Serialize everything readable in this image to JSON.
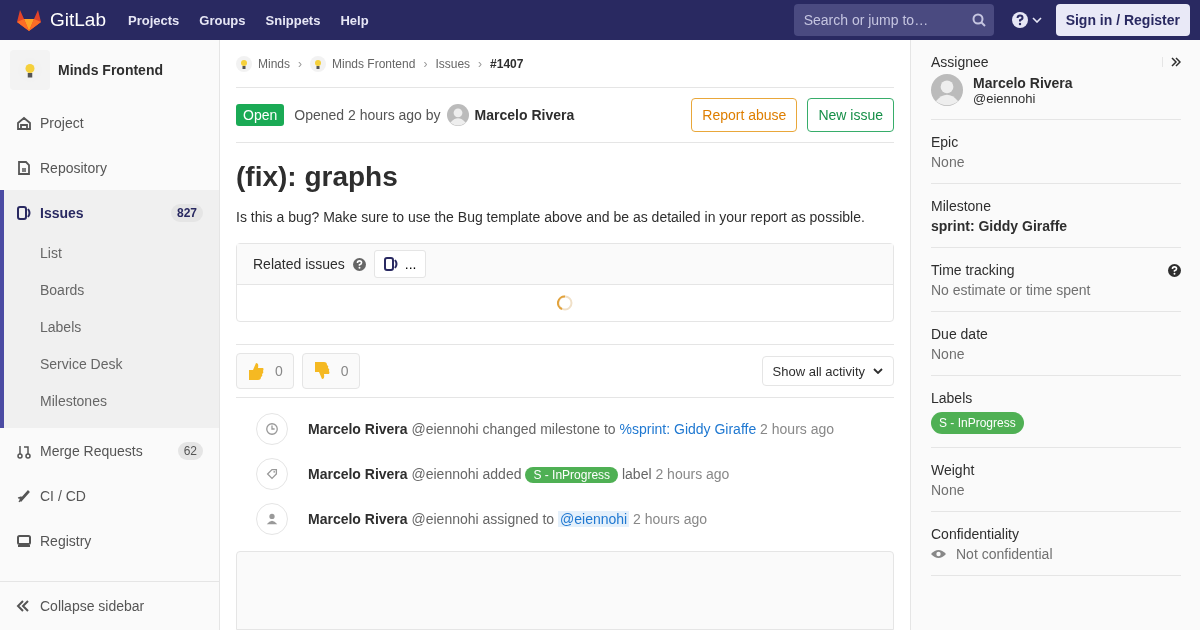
{
  "topbar": {
    "brand": "GitLab",
    "nav": [
      "Projects",
      "Groups",
      "Snippets",
      "Help"
    ],
    "search": {
      "placeholder": "Search or jump to…"
    },
    "sign_in": "Sign in / Register"
  },
  "sidebar": {
    "project": "Minds Frontend",
    "items": [
      {
        "label": "Project",
        "selected": false
      },
      {
        "label": "Repository",
        "selected": false
      },
      {
        "label": "Issues",
        "count": "827",
        "selected": true,
        "children": [
          {
            "label": "List"
          },
          {
            "label": "Boards"
          },
          {
            "label": "Labels"
          },
          {
            "label": "Service Desk"
          },
          {
            "label": "Milestones"
          }
        ]
      },
      {
        "label": "Merge Requests",
        "count": "62",
        "selected": false
      },
      {
        "label": "CI / CD",
        "selected": false
      },
      {
        "label": "Registry",
        "selected": false
      }
    ],
    "collapse": "Collapse sidebar"
  },
  "breadcrumbs": [
    {
      "label": "Minds"
    },
    {
      "separator": "›",
      "label": "Minds Frontend"
    },
    {
      "separator": "›",
      "label": "Issues"
    },
    {
      "separator": "›",
      "label": "#1407"
    }
  ],
  "issue": {
    "status": "Open",
    "opened": "Opened 2 hours ago by",
    "author": "Marcelo Rivera",
    "buttons": [
      {
        "label": "Report abuse",
        "kind": "warning"
      },
      {
        "label": "New issue",
        "kind": "success"
      }
    ],
    "title": "(fix): graphs",
    "description": "Is this a bug? Make sure to use the Bug template above and be as detailed in your report as possible.",
    "related": {
      "title": "Related issues",
      "button": "..."
    },
    "reactions": [
      {
        "kind": "up",
        "count": "0"
      },
      {
        "kind": "down",
        "count": "0"
      }
    ],
    "activity_filter": "Show all activity",
    "notes": [
      {
        "author": "Marcelo Rivera",
        "handle": "@eiennohi",
        "action": "changed milestone to",
        "target": {
          "kind": "link",
          "text": "%sprint: Giddy Giraffe"
        },
        "time": "2 hours ago"
      },
      {
        "author": "Marcelo Rivera",
        "handle": "@eiennohi",
        "action": "added",
        "target": {
          "kind": "label",
          "text": "S - InProgress",
          "color": "#4fb054"
        },
        "after": "label",
        "time": "2 hours ago"
      },
      {
        "author": "Marcelo Rivera",
        "handle": "@eiennohi",
        "action": "assigned to",
        "target": {
          "kind": "mention",
          "text": "@eiennohi"
        },
        "time": "2 hours ago"
      }
    ]
  },
  "right_sidebar": [
    {
      "kind": "user",
      "title": "Assignee",
      "name": "Marcelo Rivera",
      "handle": "@eiennohi"
    },
    {
      "kind": "muted",
      "title": "Epic",
      "value": "None"
    },
    {
      "kind": "bold",
      "title": "Milestone",
      "value": "sprint: Giddy Giraffe"
    },
    {
      "kind": "muted",
      "title": "Time tracking",
      "value": "No estimate or time spent",
      "help": true
    },
    {
      "kind": "muted",
      "title": "Due date",
      "value": "None"
    },
    {
      "kind": "label",
      "title": "Labels",
      "value": "S - InProgress",
      "color": "#4fb054"
    },
    {
      "kind": "muted",
      "title": "Weight",
      "value": "None"
    },
    {
      "kind": "eye",
      "title": "Confidentiality",
      "value": "Not confidential"
    }
  ]
}
